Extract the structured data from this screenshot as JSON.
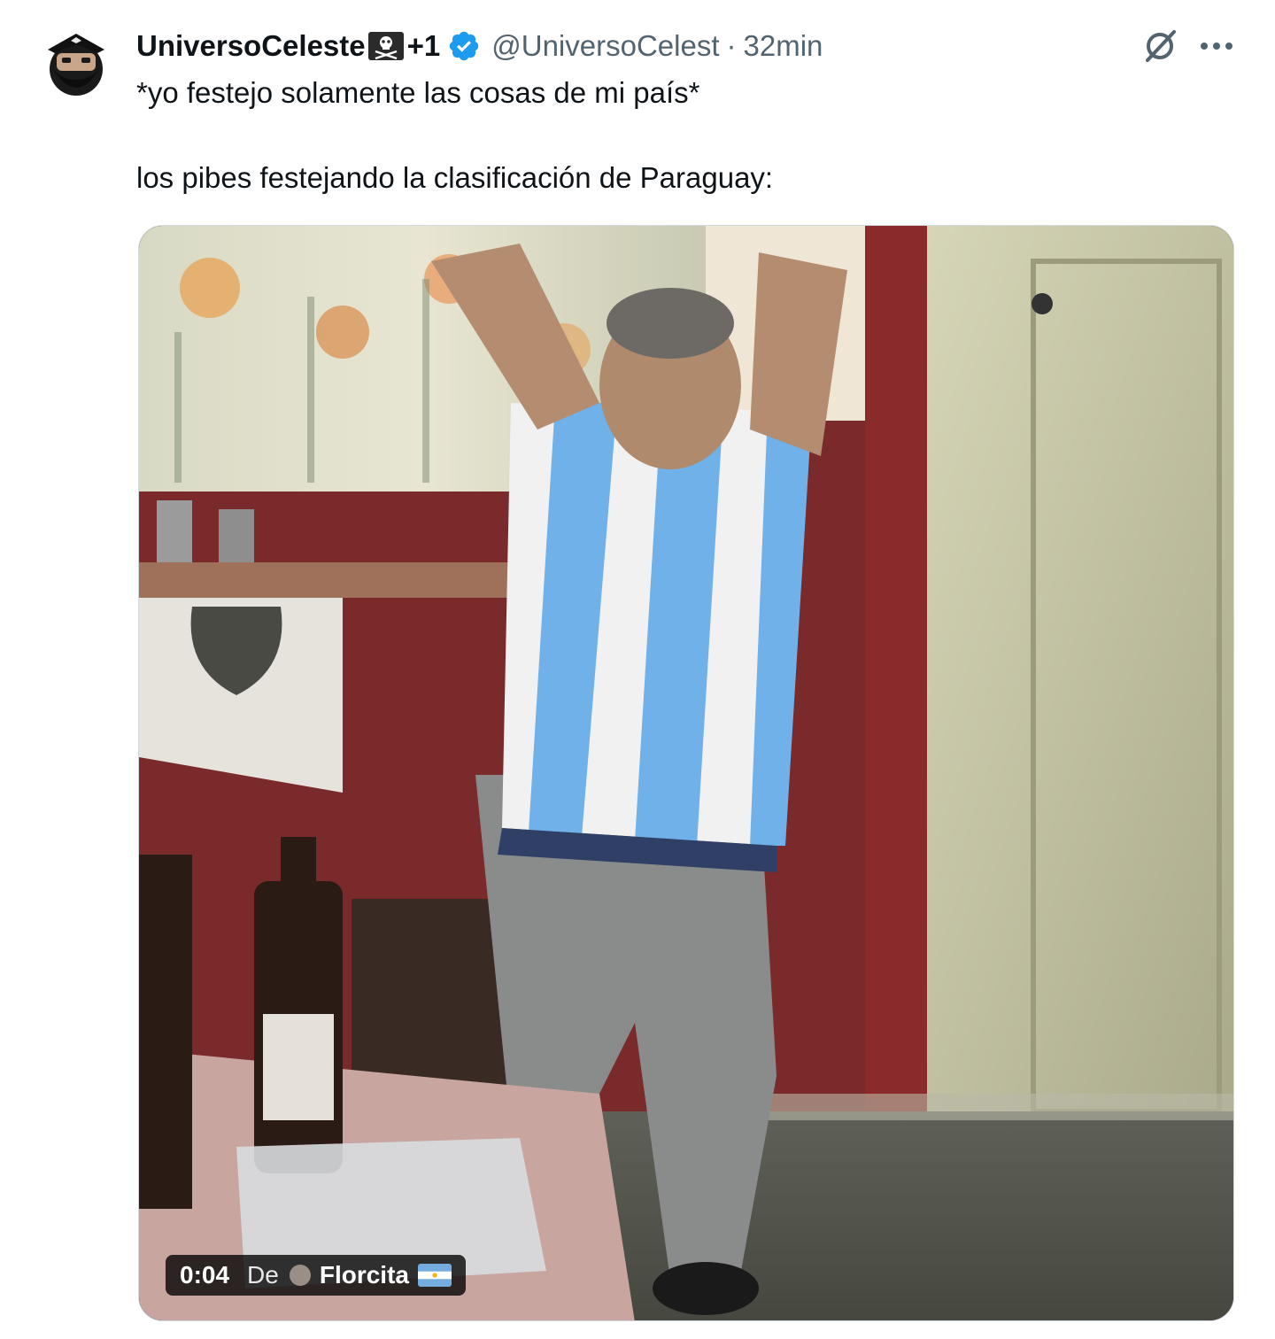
{
  "tweet": {
    "display_name": "UniversoCeleste",
    "display_name_suffix": "+1",
    "name_badge_icon": "skull-crossbones-icon",
    "verified_icon": "verified-badge-icon",
    "handle": "@UniversoCelest",
    "separator": "·",
    "time": "32min",
    "text_lines": [
      "*yo festejo solamente las cosas de mi país*",
      "los pibes festejando la clasificación de Paraguay:"
    ],
    "actions": {
      "grok_icon": "grok-icon",
      "more_icon": "more-options-icon"
    }
  },
  "media": {
    "type": "video",
    "duration": "0:04",
    "from_label": "De",
    "author": "Florcita",
    "author_flag_icon": "argentina-flag-icon"
  },
  "colors": {
    "verified_blue": "#1d9bf0",
    "text_primary": "#0f1419",
    "text_secondary": "#536471"
  }
}
